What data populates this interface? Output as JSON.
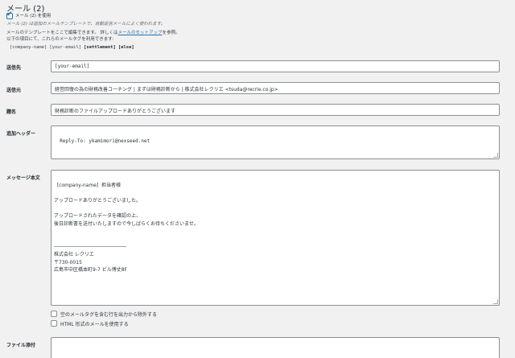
{
  "section_title": "メール (2)",
  "use_mail2": {
    "label": "メール (2) を使用",
    "checked": true
  },
  "description": {
    "line1": "メール (2) は追加のメールテンプレートで、自動返信メールによく使われます。",
    "line2_pre": "メールのテンプレートをここで編集できます。 詳しくは",
    "line2_link": "メールのセットアップ",
    "line2_post": "を参照。",
    "line3": "以下の項目にて、これらのメールタグを利用できます:"
  },
  "mail_tags": [
    {
      "text": "[company-name]",
      "bold": false
    },
    {
      "text": "[your-email]",
      "bold": false
    },
    {
      "text": "[settlement]",
      "bold": true
    },
    {
      "text": "[else]",
      "bold": true
    }
  ],
  "fields": {
    "to": {
      "label": "送信先",
      "value": "[your-email]"
    },
    "from": {
      "label": "送信元",
      "value": "経営回復の為の財務改善コーチング | まずは財務診断から | 株式会社レクリエ <tsuda@recrie.co.jp>"
    },
    "subject": {
      "label": "題名",
      "value": "財務診断のファイルアップロードありがとうございます"
    },
    "headers": {
      "label": "追加ヘッダー",
      "value": "Reply-To: ykamimori@nexseed.net"
    },
    "body": {
      "label": "メッセージ本文",
      "value": "[company-name]  担当者様\n\nアップロードありがとうございました。\n\nアップロードされたデータを確認の上、\n後日診断書を送付いたしますので今しばらくお待ちくださいませ。\n\n\n―――――――――――――――\n株式会社 レクリエ\n〒730-0015\n広島市中区橋本町9-7 ビル博丈8F"
    },
    "attachments": {
      "label": "ファイル添付",
      "value": ""
    }
  },
  "options": {
    "exclude_blank": {
      "label": "空のメールタグを含む行を出力から除外する",
      "checked": false
    },
    "use_html": {
      "label": "HTML 形式のメールを使用する",
      "checked": false
    }
  },
  "colors": {
    "link": "#2271b1",
    "border": "#8c8f94",
    "background": "#f1f1f1"
  }
}
